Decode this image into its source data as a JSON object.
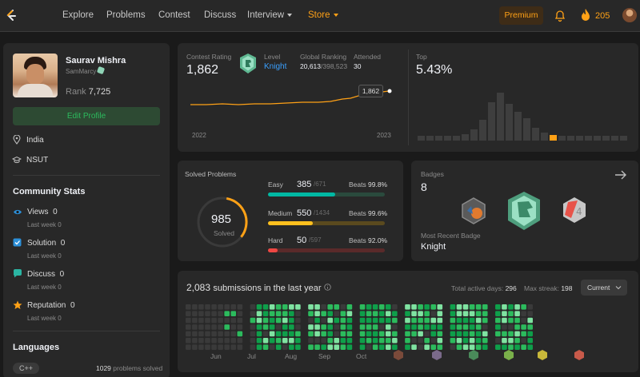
{
  "nav": {
    "items": [
      "Explore",
      "Problems",
      "Contest",
      "Discuss",
      "Interview",
      "Store"
    ],
    "premium": "Premium",
    "streak": "205"
  },
  "profile": {
    "name": "Saurav Mishra",
    "username": "SamMarcy",
    "rank_label": "Rank",
    "rank": "7,725",
    "edit_label": "Edit Profile",
    "location": "India",
    "school": "NSUT"
  },
  "community": {
    "title": "Community Stats",
    "items": [
      {
        "label": "Views",
        "value": "0",
        "sub": "Last week 0"
      },
      {
        "label": "Solution",
        "value": "0",
        "sub": "Last week 0"
      },
      {
        "label": "Discuss",
        "value": "0",
        "sub": "Last week 0"
      },
      {
        "label": "Reputation",
        "value": "0",
        "sub": "Last week 0"
      }
    ]
  },
  "languages": {
    "title": "Languages",
    "lang": "C++",
    "count": "1029",
    "count_suffix": "problems solved"
  },
  "contest": {
    "rating_label": "Contest Rating",
    "rating": "1,862",
    "level_label": "Level",
    "level": "Knight",
    "global_label": "Global Ranking",
    "global_rank": "20,613",
    "global_total": "/398,523",
    "attended_label": "Attended",
    "attended": "30",
    "tooltip": "1,862",
    "x_start": "2022",
    "x_end": "2023",
    "top_label": "Top",
    "top_value": "5.43%"
  },
  "solved": {
    "title": "Solved Problems",
    "total": "985",
    "total_label": "Solved",
    "rows": [
      {
        "label": "Easy",
        "count": "385",
        "total": "/671",
        "beats": "Beats",
        "pct": "99.8%",
        "fraction": 0.574,
        "color": "#00b8a3",
        "track": "#2a4a3d"
      },
      {
        "label": "Medium",
        "count": "550",
        "total": "/1434",
        "beats": "Beats",
        "pct": "99.6%",
        "fraction": 0.384,
        "color": "#ffc01e",
        "track": "#5a4a1e"
      },
      {
        "label": "Hard",
        "count": "50",
        "total": "/597",
        "beats": "Beats",
        "pct": "92.0%",
        "fraction": 0.084,
        "color": "#ef4743",
        "track": "#5a2a2a"
      }
    ]
  },
  "badges": {
    "title": "Badges",
    "count": "8",
    "recent_label": "Most Recent Badge",
    "recent": "Knight"
  },
  "submissions": {
    "count": "2,083",
    "text": "submissions in the last year",
    "active_label": "Total active days:",
    "active": "296",
    "streak_label": "Max streak:",
    "streak": "198",
    "dropdown": "Current",
    "months": [
      "Jun",
      "Jul",
      "Aug",
      "Sep",
      "Oct"
    ]
  },
  "colors": {
    "accent": "#ffa116",
    "green": "#2cbb5d",
    "easy": "#00b8a3",
    "medium": "#ffc01e",
    "hard": "#ef4743"
  },
  "chart_data": {
    "type": "line",
    "x_labels": [
      "2022",
      "2023"
    ],
    "current_value": 1862,
    "histogram_title": "Top",
    "histogram_value": "5.43%"
  }
}
